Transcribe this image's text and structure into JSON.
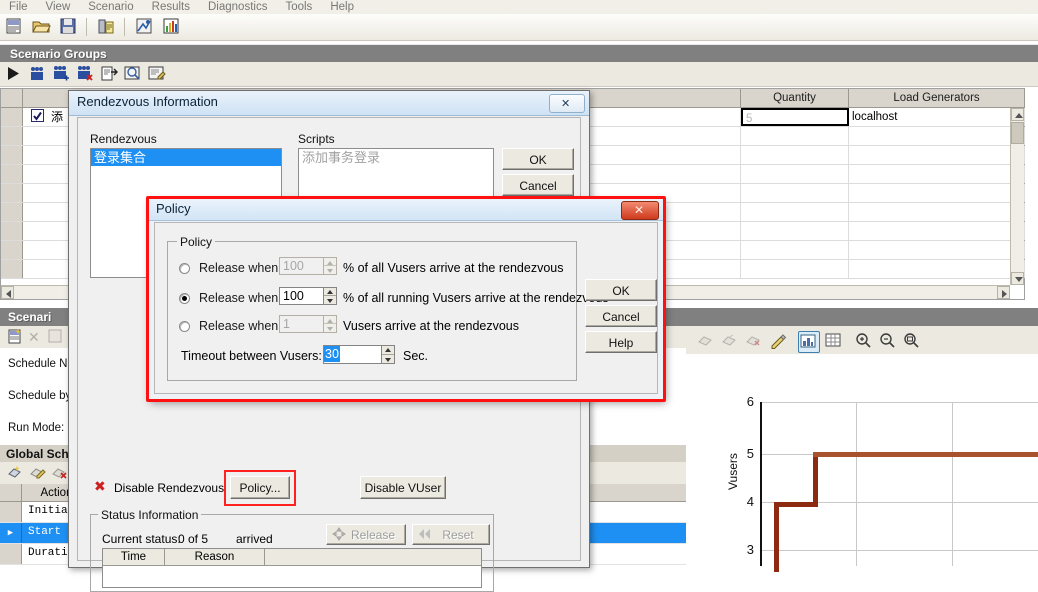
{
  "menu": {
    "items": [
      "File",
      "View",
      "Scenario",
      "Results",
      "Diagnostics",
      "Tools",
      "Help"
    ]
  },
  "main_toolbar": {
    "icons": [
      "new-scenario-icon",
      "open-scenario-icon",
      "save-scenario-icon",
      "report-icon",
      "analysis-icon",
      "graph-icon"
    ]
  },
  "scenario_groups": {
    "title": "Scenario Groups",
    "toolbar_icons": [
      "run-icon",
      "add-group-icon",
      "add-vuser-icon",
      "remove-vuser-icon",
      "details-icon",
      "view-script-icon",
      "edit-script-icon"
    ],
    "columns": [
      "",
      "",
      "Quantity",
      "Load Generators"
    ],
    "rows": [
      {
        "checked": true,
        "name": "添",
        "quantity": "5",
        "load_generator": "localhost"
      }
    ]
  },
  "schedule_pane": {
    "title": "Scenari",
    "labels": [
      "Schedule N",
      "Schedule by",
      "Run Mode:"
    ]
  },
  "global_schedule": {
    "title": "Global Sch",
    "columns": [
      "",
      "Action"
    ],
    "rows": [
      {
        "marker": "",
        "action": "Initia"
      },
      {
        "marker": "▶",
        "action": "Start",
        "selected": true
      },
      {
        "marker": "",
        "action": "Durati"
      }
    ]
  },
  "chart": {
    "toolbar_icons": [
      "cut-icon",
      "copy-icon",
      "delete-icon",
      "edit-icon",
      "grid-view-icon",
      "table-view-icon",
      "zoom-in-icon",
      "zoom-out-icon",
      "zoom-reset-icon"
    ],
    "selected_tool": "grid-view-icon"
  },
  "chart_data": {
    "type": "line",
    "title": "",
    "xlabel": "",
    "ylabel": "Vusers",
    "ylim": [
      2,
      6
    ],
    "yticks": [
      6,
      5,
      4,
      3
    ],
    "series": [
      {
        "name": "Vusers",
        "steps": [
          [
            0,
            2
          ],
          [
            0,
            4
          ],
          [
            0.28,
            4
          ],
          [
            0.28,
            5
          ],
          [
            1,
            5
          ]
        ]
      }
    ],
    "grid": true,
    "legend": "none",
    "line_color": "#a8522e"
  },
  "rendezvous_dialog": {
    "title": "Rendezvous Information",
    "close_icon": "close-icon",
    "rendezvous_label": "Rendezvous",
    "rendezvous_items": [
      "登录集合"
    ],
    "scripts_label": "Scripts",
    "scripts_items": [
      "添加事务登录"
    ],
    "ok_label": "OK",
    "cancel_label": "Cancel",
    "disable_rendezvous_label": "Disable Rendezvous",
    "disable_rendezvous_icon": "x-icon",
    "policy_button_label": "Policy...",
    "disable_vuser_label": "Disable VUser",
    "status_group_label": "Status Information",
    "current_status_label": "Current status:",
    "current_status_value": "0 of 5",
    "arrived_label": "arrived",
    "release_label": "Release",
    "release_icon": "release-icon",
    "reset_label": "Reset",
    "reset_icon": "reset-icon",
    "status_columns": [
      "Time",
      "Reason"
    ]
  },
  "policy_dialog": {
    "title": "Policy",
    "close_icon": "close-icon",
    "group_label": "Policy",
    "options": [
      {
        "label": "Release when",
        "value": "100",
        "suffix": "% of all Vusers arrive at the rendezvous",
        "selected": false,
        "enabled": false
      },
      {
        "label": "Release when",
        "value": "100",
        "suffix": "% of all running Vusers arrive at the rendezvous",
        "selected": true,
        "enabled": true
      },
      {
        "label": "Release when",
        "value": "1",
        "suffix": "Vusers arrive at the rendezvous",
        "selected": false,
        "enabled": false
      }
    ],
    "timeout_label": "Timeout between Vusers:",
    "timeout_value": "30",
    "timeout_unit": "Sec.",
    "ok_label": "OK",
    "cancel_label": "Cancel",
    "help_label": "Help"
  },
  "colors": {
    "highlight_blue": "#1e90f3",
    "annotation_red": "#ff1111",
    "titlebar_gray": "#808080",
    "chart_line": "#a8522e"
  }
}
